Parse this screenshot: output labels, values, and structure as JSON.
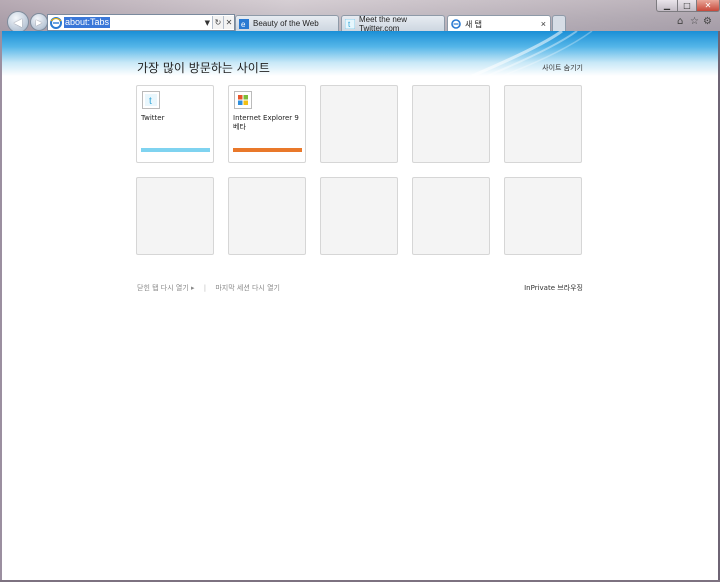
{
  "browser": {
    "address": {
      "url": "about:Tabs"
    },
    "tabs": [
      {
        "label": "Beauty of the Web",
        "active": false,
        "icon": "ie-icon"
      },
      {
        "label": "Meet the new Twitter.com",
        "active": false,
        "icon": "twitter-icon"
      },
      {
        "label": "새 탭",
        "active": true,
        "icon": "ie-icon"
      }
    ],
    "close_glyph": "×",
    "colors": {
      "banner": "#1a8fd6",
      "twitter_bar": "#7fd3f0",
      "ie_bar": "#e9782a"
    }
  },
  "newtab": {
    "heading": "가장 많이 방문하는 사이트",
    "hide_sites": "사이트 숨기기",
    "sites": [
      {
        "title": "Twitter",
        "icon": "twitter-icon"
      },
      {
        "title": "Internet Explorer 9 베타",
        "icon": "windows-icon"
      }
    ],
    "footer": {
      "reopen_closed": "닫힌 탭 다시 열기",
      "reopen_arrow": "▸",
      "separator": "|",
      "reopen_session": "마지막 세션 다시 열기",
      "inprivate": "InPrivate 브라우징"
    }
  }
}
